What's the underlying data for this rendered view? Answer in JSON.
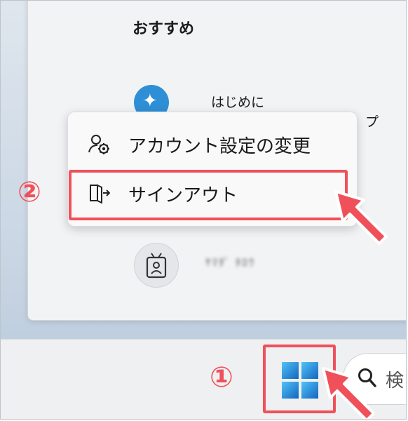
{
  "start_menu": {
    "heading": "おすすめ",
    "recommended": {
      "label": "はじめに",
      "sublabel": "プ"
    },
    "user": {
      "name": "ﾔﾏﾀﾞ ﾀﾛｳ"
    }
  },
  "context_menu": {
    "items": [
      {
        "label": "アカウント設定の変更",
        "icon": "person-gear-icon"
      },
      {
        "label": "サインアウト",
        "icon": "sign-out-icon"
      }
    ]
  },
  "annotations": {
    "step1": "①",
    "step2": "②",
    "color": "#f0505a"
  },
  "taskbar": {
    "search_text": "検"
  }
}
